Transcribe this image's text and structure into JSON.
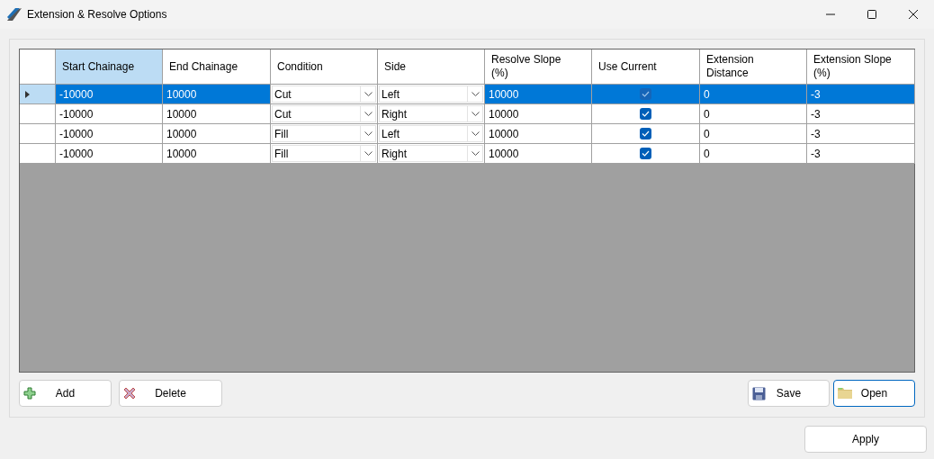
{
  "window": {
    "title": "Extension & Resolve Options"
  },
  "table": {
    "columns": [
      {
        "label": "Start Chainage",
        "selected": true
      },
      {
        "label": "End Chainage",
        "selected": false
      },
      {
        "label": "Condition",
        "selected": false
      },
      {
        "label": "Side",
        "selected": false
      },
      {
        "label": "Resolve Slope (%)",
        "selected": false
      },
      {
        "label": "Use Current",
        "selected": false
      },
      {
        "label": "Extension Distance",
        "selected": false
      },
      {
        "label": "Extension Slope (%)",
        "selected": false
      }
    ],
    "rows": [
      {
        "selected": true,
        "cells": [
          {
            "kind": "text",
            "text": "-10000"
          },
          {
            "kind": "text",
            "text": "10000"
          },
          {
            "kind": "combo",
            "text": "Cut"
          },
          {
            "kind": "combo",
            "text": "Left"
          },
          {
            "kind": "text",
            "text": "10000"
          },
          {
            "kind": "check",
            "checked": true
          },
          {
            "kind": "text",
            "text": "0"
          },
          {
            "kind": "text",
            "text": "-3"
          }
        ]
      },
      {
        "selected": false,
        "cells": [
          {
            "kind": "text",
            "text": "-10000"
          },
          {
            "kind": "text",
            "text": "10000"
          },
          {
            "kind": "combo",
            "text": "Cut"
          },
          {
            "kind": "combo",
            "text": "Right"
          },
          {
            "kind": "text",
            "text": "10000"
          },
          {
            "kind": "check",
            "checked": true
          },
          {
            "kind": "text",
            "text": "0"
          },
          {
            "kind": "text",
            "text": "-3"
          }
        ]
      },
      {
        "selected": false,
        "cells": [
          {
            "kind": "text",
            "text": "-10000"
          },
          {
            "kind": "text",
            "text": "10000"
          },
          {
            "kind": "combo",
            "text": "Fill"
          },
          {
            "kind": "combo",
            "text": "Left"
          },
          {
            "kind": "text",
            "text": "10000"
          },
          {
            "kind": "check",
            "checked": true
          },
          {
            "kind": "text",
            "text": "0"
          },
          {
            "kind": "text",
            "text": "-3"
          }
        ]
      },
      {
        "selected": false,
        "cells": [
          {
            "kind": "text",
            "text": "-10000"
          },
          {
            "kind": "text",
            "text": "10000"
          },
          {
            "kind": "combo",
            "text": "Fill"
          },
          {
            "kind": "combo",
            "text": "Right"
          },
          {
            "kind": "text",
            "text": "10000"
          },
          {
            "kind": "check",
            "checked": true
          },
          {
            "kind": "text",
            "text": "0"
          },
          {
            "kind": "text",
            "text": "-3"
          }
        ]
      }
    ]
  },
  "left_buttons": [
    {
      "kind": "add",
      "label": "Add"
    },
    {
      "kind": "delete",
      "label": "Delete"
    }
  ],
  "right_buttons": [
    {
      "kind": "save",
      "label": "Save",
      "focused": false
    },
    {
      "kind": "open",
      "label": "Open",
      "focused": true
    }
  ],
  "apply_button": {
    "label": "Apply"
  }
}
